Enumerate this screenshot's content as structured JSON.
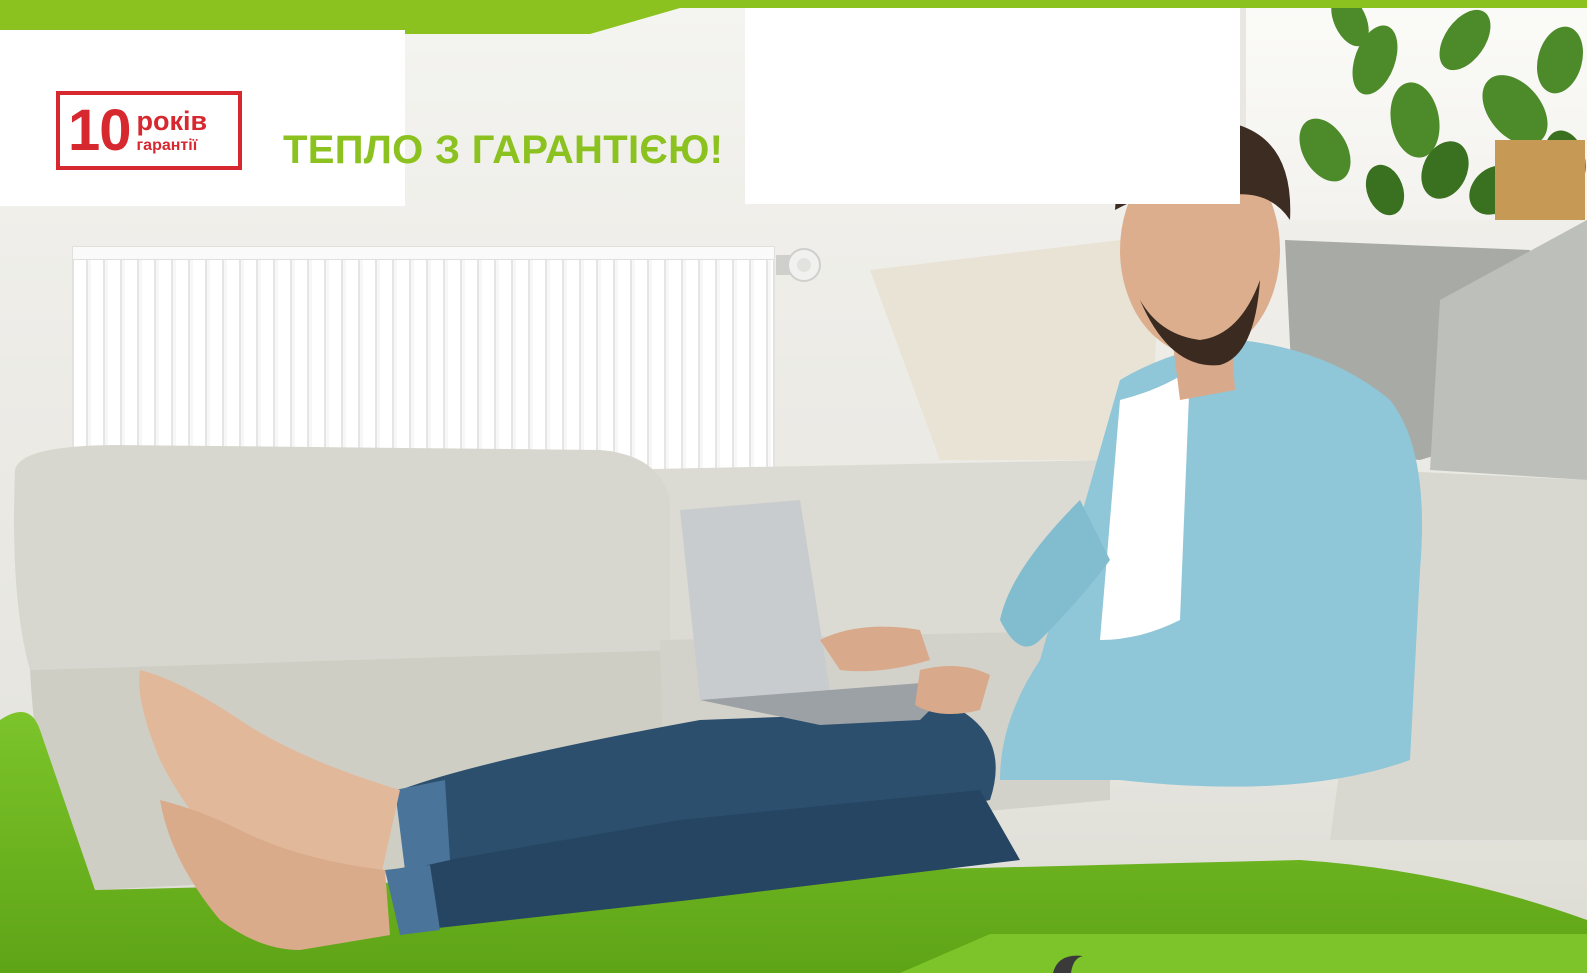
{
  "badge": {
    "number": "10",
    "years": "років",
    "guarantee": "гарантії"
  },
  "slogan": "ТЕПЛО З ГАРАНТІЄЮ!",
  "colors": {
    "brand_green": "#8cc21f",
    "badge_red": "#d7282f",
    "carpet_green": "#6cb41c"
  },
  "icons": {
    "badge": "warranty-badge-icon",
    "thermostat": "thermostat-icon",
    "brand": "brand-logo-icon"
  }
}
